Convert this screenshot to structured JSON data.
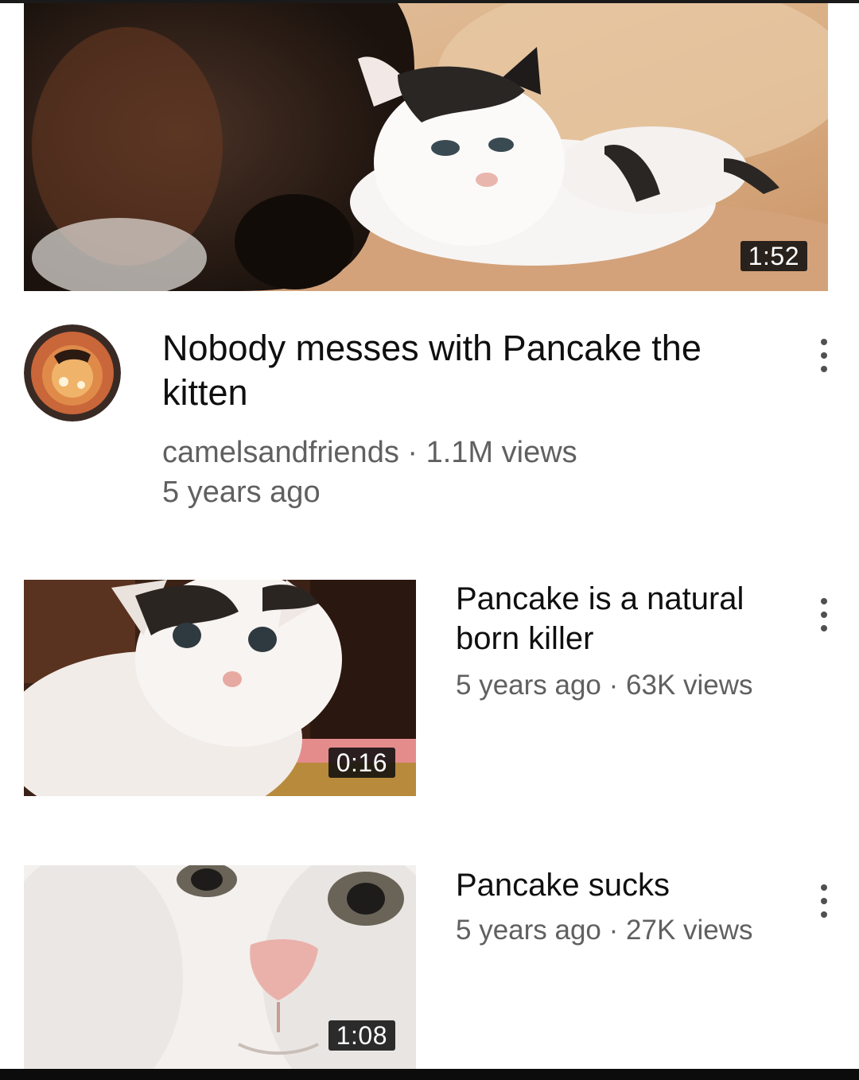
{
  "featured": {
    "duration": "1:52",
    "title": "Nobody messes with Pancake the kitten",
    "channel": "camelsandfriends",
    "separator": "·",
    "views": "1.1M views",
    "age": "5 years ago",
    "avatar_icon": "channel-avatar-cat-icon",
    "menu_icon": "more-vert-icon"
  },
  "related": [
    {
      "title": "Pancake is a natural born killer",
      "age": "5 years ago",
      "separator": "·",
      "views": "63K views",
      "duration": "0:16",
      "menu_icon": "more-vert-icon"
    },
    {
      "title": "Pancake sucks",
      "age": "5 years ago",
      "separator": "·",
      "views": "27K views",
      "duration": "1:08",
      "menu_icon": "more-vert-icon"
    }
  ],
  "colors": {
    "title_text": "#0f0f0f",
    "meta_text": "#606060",
    "duration_badge": "#0a0a0a",
    "avatar_ring": "#c9663a"
  }
}
